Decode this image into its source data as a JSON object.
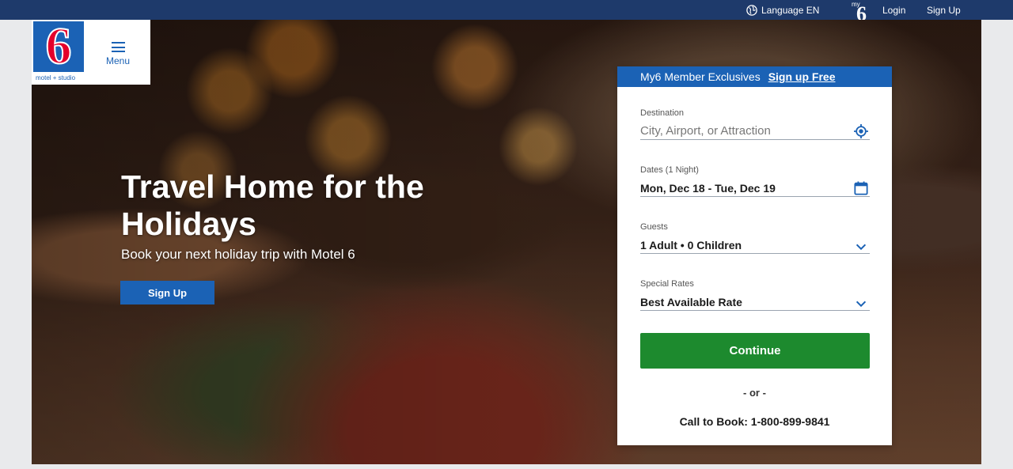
{
  "topbar": {
    "language_label": "Language EN",
    "my6_label": "my",
    "login_label": "Login",
    "signup_label": "Sign Up"
  },
  "logo": {
    "mark": "6",
    "caption": "motel + studio",
    "brand_color": "#1b62b5",
    "mark_color": "#e4002b"
  },
  "menu": {
    "label": "Menu"
  },
  "hero": {
    "title": "Travel Home for the Holidays",
    "subtitle": "Book your next holiday trip with Motel 6",
    "cta_label": "Sign Up"
  },
  "booking": {
    "header_text": "My6 Member Exclusives",
    "header_link": "Sign up Free",
    "destination": {
      "label": "Destination",
      "placeholder": "City, Airport, or Attraction",
      "icon": "locate-icon"
    },
    "dates": {
      "label": "Dates (1 Night)",
      "value": "Mon, Dec 18 - Tue, Dec 19",
      "icon": "calendar-icon"
    },
    "guests": {
      "label": "Guests",
      "value": "1 Adult • 0 Children",
      "icon": "chevron-down-icon"
    },
    "rates": {
      "label": "Special Rates",
      "value": "Best Available Rate",
      "icon": "chevron-down-icon"
    },
    "continue_label": "Continue",
    "or_text": "- or -",
    "call_prefix": "Call to Book:",
    "phone": "1-800-899-9841",
    "continue_color": "#1d8a2e"
  }
}
